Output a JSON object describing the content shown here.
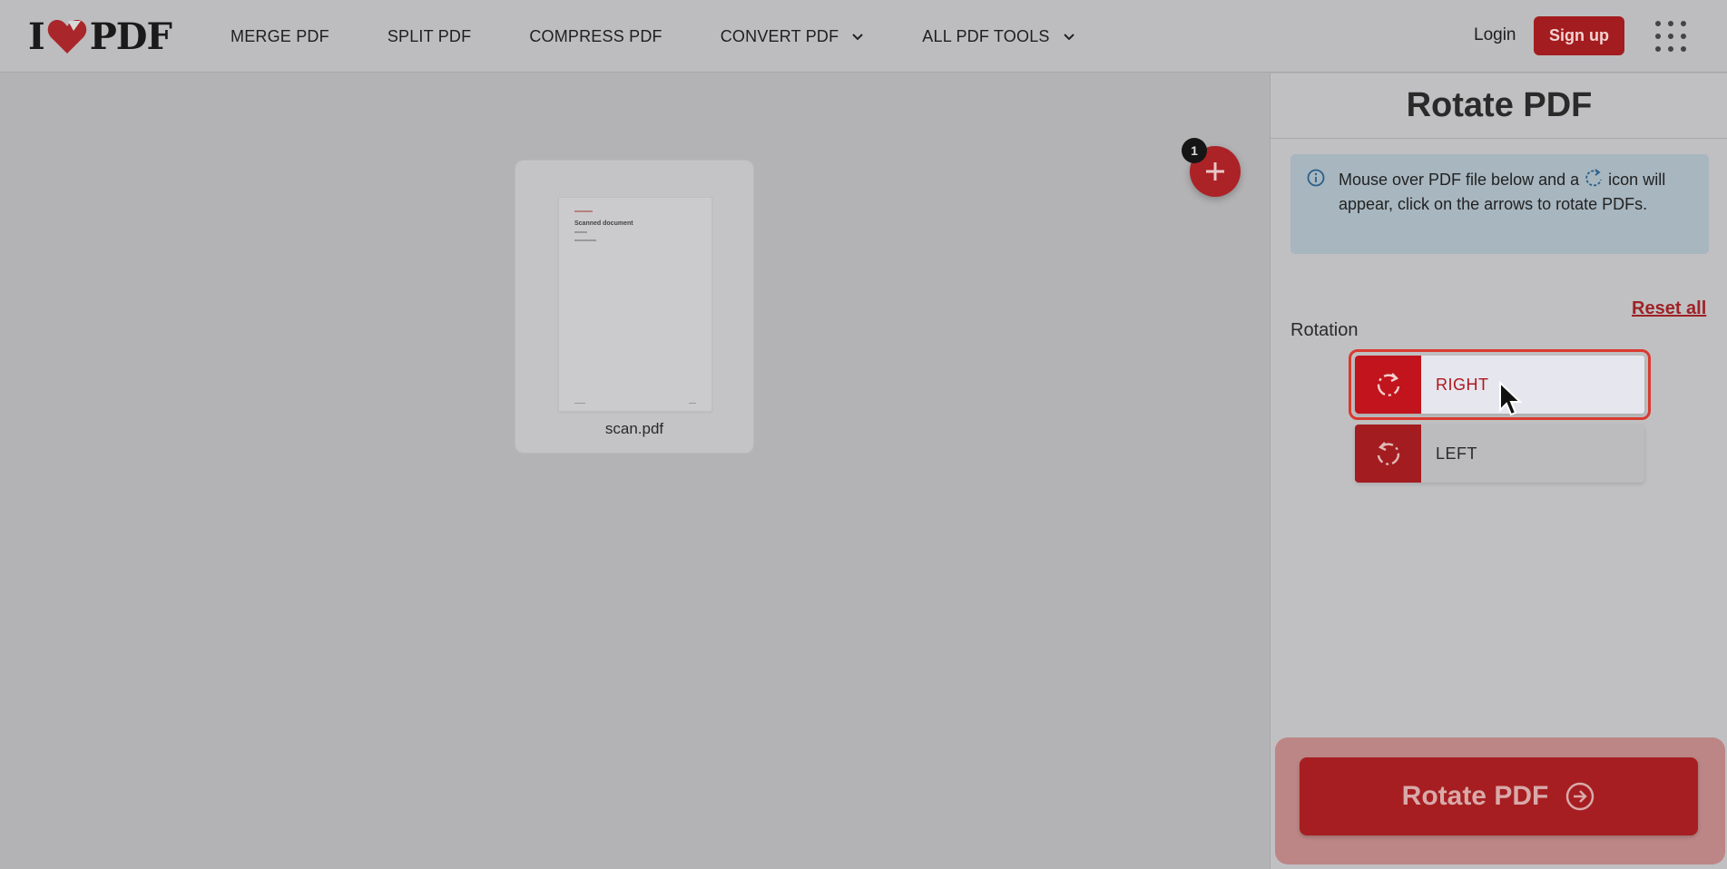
{
  "header": {
    "logo": {
      "left": "I",
      "right": "PDF"
    },
    "nav": [
      {
        "label": "MERGE PDF",
        "dropdown": false
      },
      {
        "label": "SPLIT PDF",
        "dropdown": false
      },
      {
        "label": "COMPRESS PDF",
        "dropdown": false
      },
      {
        "label": "CONVERT PDF",
        "dropdown": true
      },
      {
        "label": "ALL PDF TOOLS",
        "dropdown": true
      }
    ],
    "login": "Login",
    "signup": "Sign up",
    "apps_icon": "grid-icon"
  },
  "workspace": {
    "file": {
      "name": "scan.pdf",
      "thumb_title": "Scanned document"
    },
    "file_count": "1"
  },
  "sidebar": {
    "title": "Rotate PDF",
    "info": {
      "before": "Mouse over PDF file below and a",
      "after": "icon will appear, click on the arrows to rotate PDFs."
    },
    "reset_all": "Reset all",
    "rotation_label": "Rotation",
    "options": [
      {
        "label": "RIGHT",
        "selected": true
      },
      {
        "label": "LEFT",
        "selected": false
      }
    ],
    "action": "Rotate PDF"
  },
  "colors": {
    "brand": "#e5322d",
    "info_bg": "#d1e6f4"
  }
}
